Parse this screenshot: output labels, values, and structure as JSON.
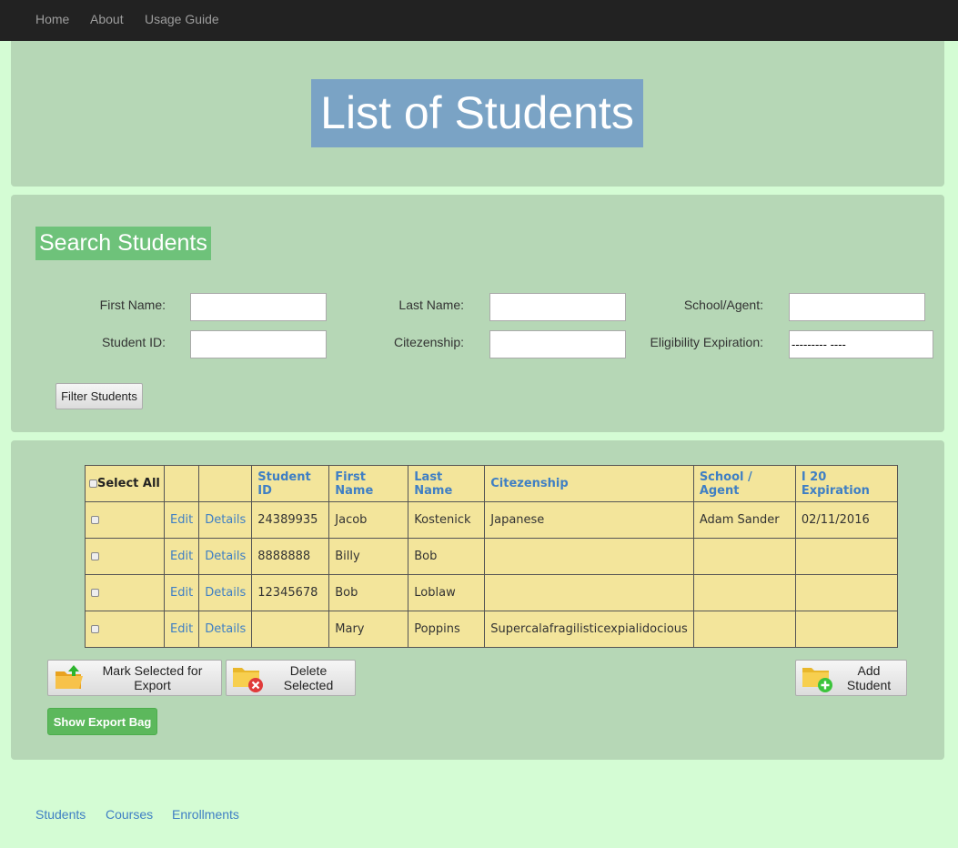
{
  "nav": {
    "items": [
      "Home",
      "About",
      "Usage Guide"
    ]
  },
  "page": {
    "title": "List of Students"
  },
  "search": {
    "title": "Search Students",
    "fields": {
      "first_name": {
        "label": "First Name:",
        "value": ""
      },
      "last_name": {
        "label": "Last Name:",
        "value": ""
      },
      "school_agent": {
        "label": "School/Agent:",
        "value": ""
      },
      "student_id": {
        "label": "Student ID:",
        "value": ""
      },
      "citezenship": {
        "label": "Citezenship:",
        "value": ""
      },
      "eligibility": {
        "label": "Eligibility Expiration:",
        "value": "--------- ----"
      }
    },
    "filter_button": "Filter Students"
  },
  "table": {
    "select_all": "Select All",
    "headers": [
      "Student ID",
      "First Name",
      "Last Name",
      "Citezenship",
      "School / Agent",
      "I 20 Expiration"
    ],
    "edit_label": "Edit",
    "details_label": "Details",
    "rows": [
      {
        "student_id": "24389935",
        "first_name": "Jacob",
        "last_name": "Kostenick",
        "citezenship": "Japanese",
        "school_agent": "Adam Sander",
        "i20_expiration": "02/11/2016"
      },
      {
        "student_id": "8888888",
        "first_name": "Billy",
        "last_name": "Bob",
        "citezenship": "",
        "school_agent": "",
        "i20_expiration": ""
      },
      {
        "student_id": "12345678",
        "first_name": "Bob",
        "last_name": "Loblaw",
        "citezenship": "",
        "school_agent": "",
        "i20_expiration": ""
      },
      {
        "student_id": "",
        "first_name": "Mary",
        "last_name": "Poppins",
        "citezenship": "Supercalafragilisticexpialidocious",
        "school_agent": "",
        "i20_expiration": ""
      }
    ]
  },
  "actions": {
    "mark_export": "Mark Selected for Export",
    "delete_selected": "Delete Selected",
    "add_student": "Add Student",
    "show_export_bag": "Show Export Bag"
  },
  "footer": {
    "links": [
      "Students",
      "Courses",
      "Enrollments"
    ]
  }
}
